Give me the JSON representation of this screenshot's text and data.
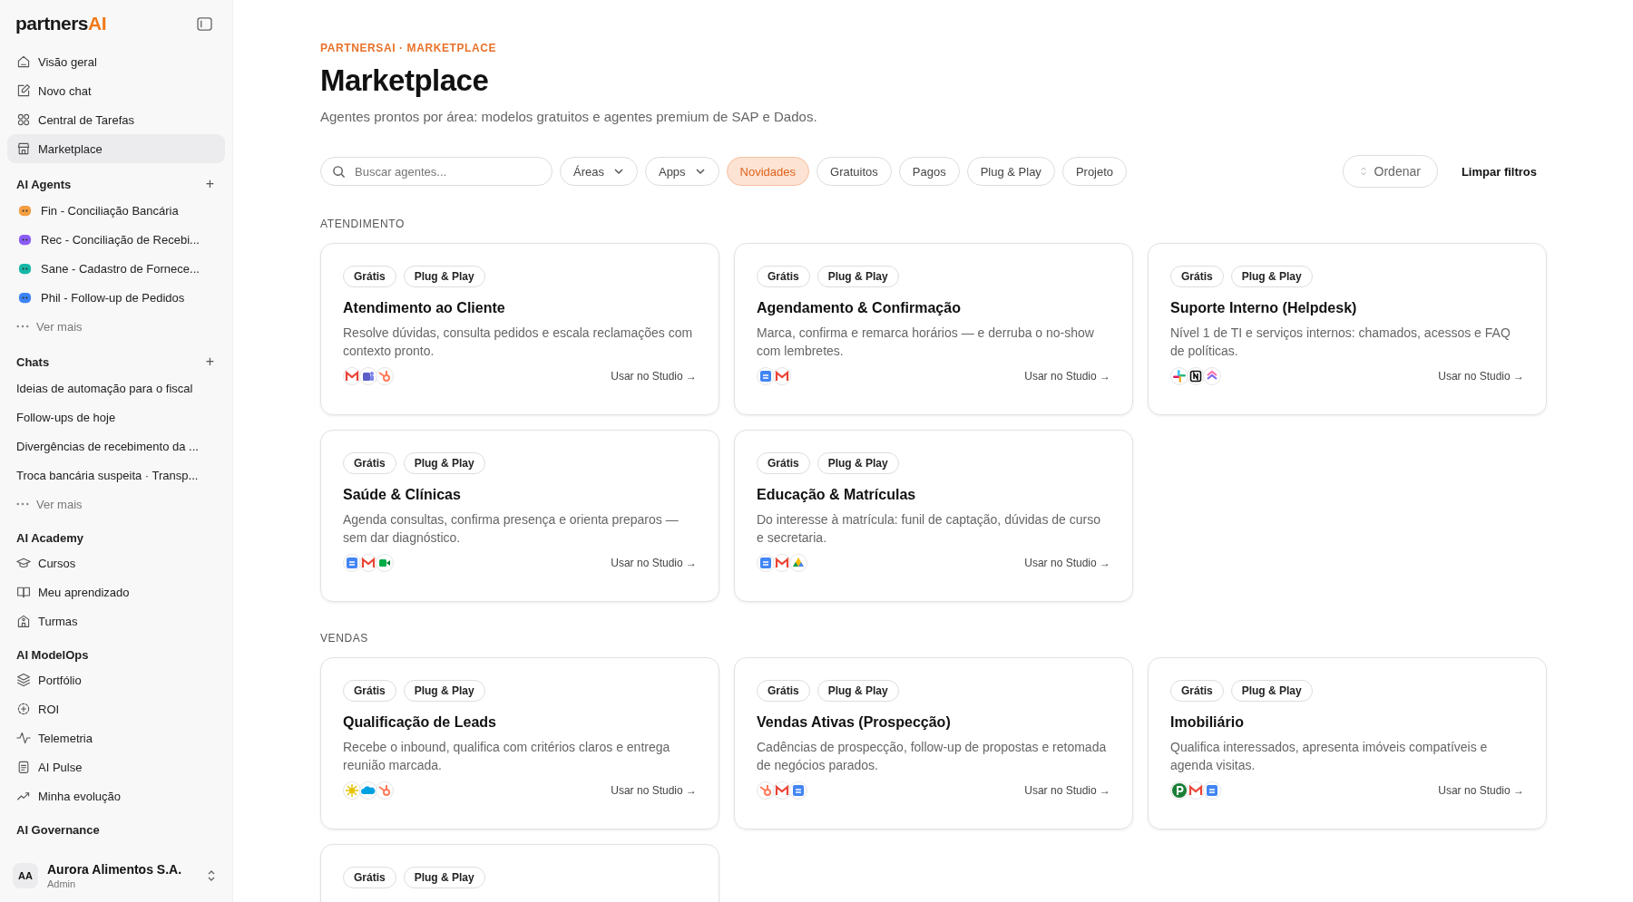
{
  "sidebar": {
    "logo": {
      "main": "partners",
      "accent": "AI"
    },
    "nav": [
      {
        "label": "Visão geral",
        "selected": false
      },
      {
        "label": "Novo chat",
        "selected": false
      },
      {
        "label": "Central de Tarefas",
        "selected": false
      },
      {
        "label": "Marketplace",
        "selected": true
      }
    ],
    "agents": {
      "title": "AI Agents",
      "add": "+",
      "items": [
        {
          "label": "Fin - Conciliação Bancária",
          "color": "#f59e42"
        },
        {
          "label": "Rec - Conciliação de Recebi...",
          "color": "#8b5cf6"
        },
        {
          "label": "Sane - Cadastro de Fornece...",
          "color": "#14b8a6"
        },
        {
          "label": "Phil - Follow-up de Pedidos",
          "color": "#3b82f6"
        }
      ],
      "more": "Ver mais"
    },
    "chats": {
      "title": "Chats",
      "add": "+",
      "items": [
        "Ideias de automação para o fiscal",
        "Follow-ups de hoje",
        "Divergências de recebimento da ...",
        "Troca bancária suspeita · Transp..."
      ],
      "more": "Ver mais"
    },
    "sections": [
      {
        "title": "AI Academy",
        "items": [
          "Cursos",
          "Meu aprendizado",
          "Turmas"
        ]
      },
      {
        "title": "AI ModelOps",
        "items": [
          "Portfólio",
          "ROI",
          "Telemetria",
          "AI Pulse",
          "Minha evolução"
        ]
      },
      {
        "title": "AI Governance"
      }
    ],
    "account": {
      "initials": "AA",
      "name": "Aurora Alimentos S.A.",
      "role": "Admin"
    }
  },
  "header": {
    "breadcrumb": "PARTNERSAI · MARKETPLACE",
    "title": "Marketplace",
    "subtitle": "Agentes prontos por área: modelos gratuitos e agentes premium de SAP e Dados."
  },
  "filters": {
    "search": {
      "placeholder": "Buscar agentes..."
    },
    "chips": [
      {
        "label": "Áreas",
        "kind": "dropdown",
        "selected": false
      },
      {
        "label": "Apps",
        "kind": "dropdown",
        "selected": false
      },
      {
        "label": "Novidades",
        "kind": "toggle",
        "selected": true
      },
      {
        "label": "Gratuitos",
        "kind": "toggle",
        "selected": false
      },
      {
        "label": "Pagos",
        "kind": "toggle",
        "selected": false
      },
      {
        "label": "Plug & Play",
        "kind": "toggle",
        "selected": false
      },
      {
        "label": "Projeto",
        "kind": "toggle",
        "selected": false
      }
    ],
    "sort": "Ordenar",
    "clear": "Limpar filtros"
  },
  "sections": [
    {
      "title": "ATENDIMENTO",
      "cards": [
        {
          "tags": [
            "Grátis",
            "Plug & Play"
          ],
          "title": "Atendimento ao Cliente",
          "description": "Resolve dúvidas, consulta pedidos e escala reclamações com contexto pronto.",
          "action": "Usar no Studio →"
        },
        {
          "tags": [
            "Grátis",
            "Plug & Play"
          ],
          "title": "Agendamento & Confirmação",
          "description": "Marca, confirma e remarca horários — e derruba o no-show com lembretes.",
          "action": "Usar no Studio →"
        },
        {
          "tags": [
            "Grátis",
            "Plug & Play"
          ],
          "title": "Suporte Interno (Helpdesk)",
          "description": "Nível 1 de TI e serviços internos: chamados, acessos e FAQ de políticas.",
          "action": "Usar no Studio →"
        },
        {
          "tags": [
            "Grátis",
            "Plug & Play"
          ],
          "title": "Saúde & Clínicas",
          "description": "Agenda consultas, confirma presença e orienta preparos — sem dar diagnóstico.",
          "action": "Usar no Studio →"
        },
        {
          "tags": [
            "Grátis",
            "Plug & Play"
          ],
          "title": "Educação & Matrículas",
          "description": "Do interesse à matrícula: funil de captação, dúvidas de curso e secretaria.",
          "action": "Usar no Studio →"
        }
      ]
    },
    {
      "title": "VENDAS",
      "cards": [
        {
          "tags": [
            "Grátis",
            "Plug & Play"
          ],
          "title": "Qualificação de Leads",
          "description": "Recebe o inbound, qualifica com critérios claros e entrega reunião marcada.",
          "action": "Usar no Studio →"
        },
        {
          "tags": [
            "Grátis",
            "Plug & Play"
          ],
          "title": "Vendas Ativas (Prospecção)",
          "description": "Cadências de prospecção, follow-up de propostas e retomada de negócios parados.",
          "action": "Usar no Studio →"
        },
        {
          "tags": [
            "Grátis",
            "Plug & Play"
          ],
          "title": "Imobiliário",
          "description": "Qualifica interessados, apresenta imóveis compatíveis e agenda visitas.",
          "action": "Usar no Studio →"
        },
        {
          "tags": [
            "Grátis",
            "Plug & Play"
          ]
        }
      ]
    }
  ]
}
